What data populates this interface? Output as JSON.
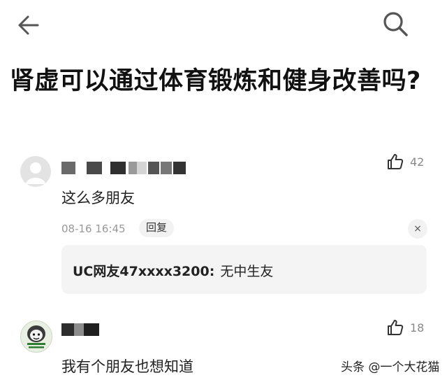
{
  "header": {
    "back_icon": "arrow-left-icon",
    "search_icon": "search-icon"
  },
  "question": {
    "title": "肾虚可以通过体育锻炼和健身改善吗?"
  },
  "comments": [
    {
      "likes": "42",
      "text": "这么多朋友",
      "time": "08-16 16:45",
      "reply_label": "回复",
      "close_label": "×",
      "reply": {
        "user": "UC网友47xxxx3200",
        "separator": ":",
        "text": "无中生友"
      }
    },
    {
      "likes": "18",
      "text": "我有个朋友也想知道"
    }
  ],
  "watermark": "头条 @一个大花猫",
  "colors": {
    "accent": "#222222",
    "muted": "#999999",
    "reply_bg": "#f4f4f4"
  }
}
